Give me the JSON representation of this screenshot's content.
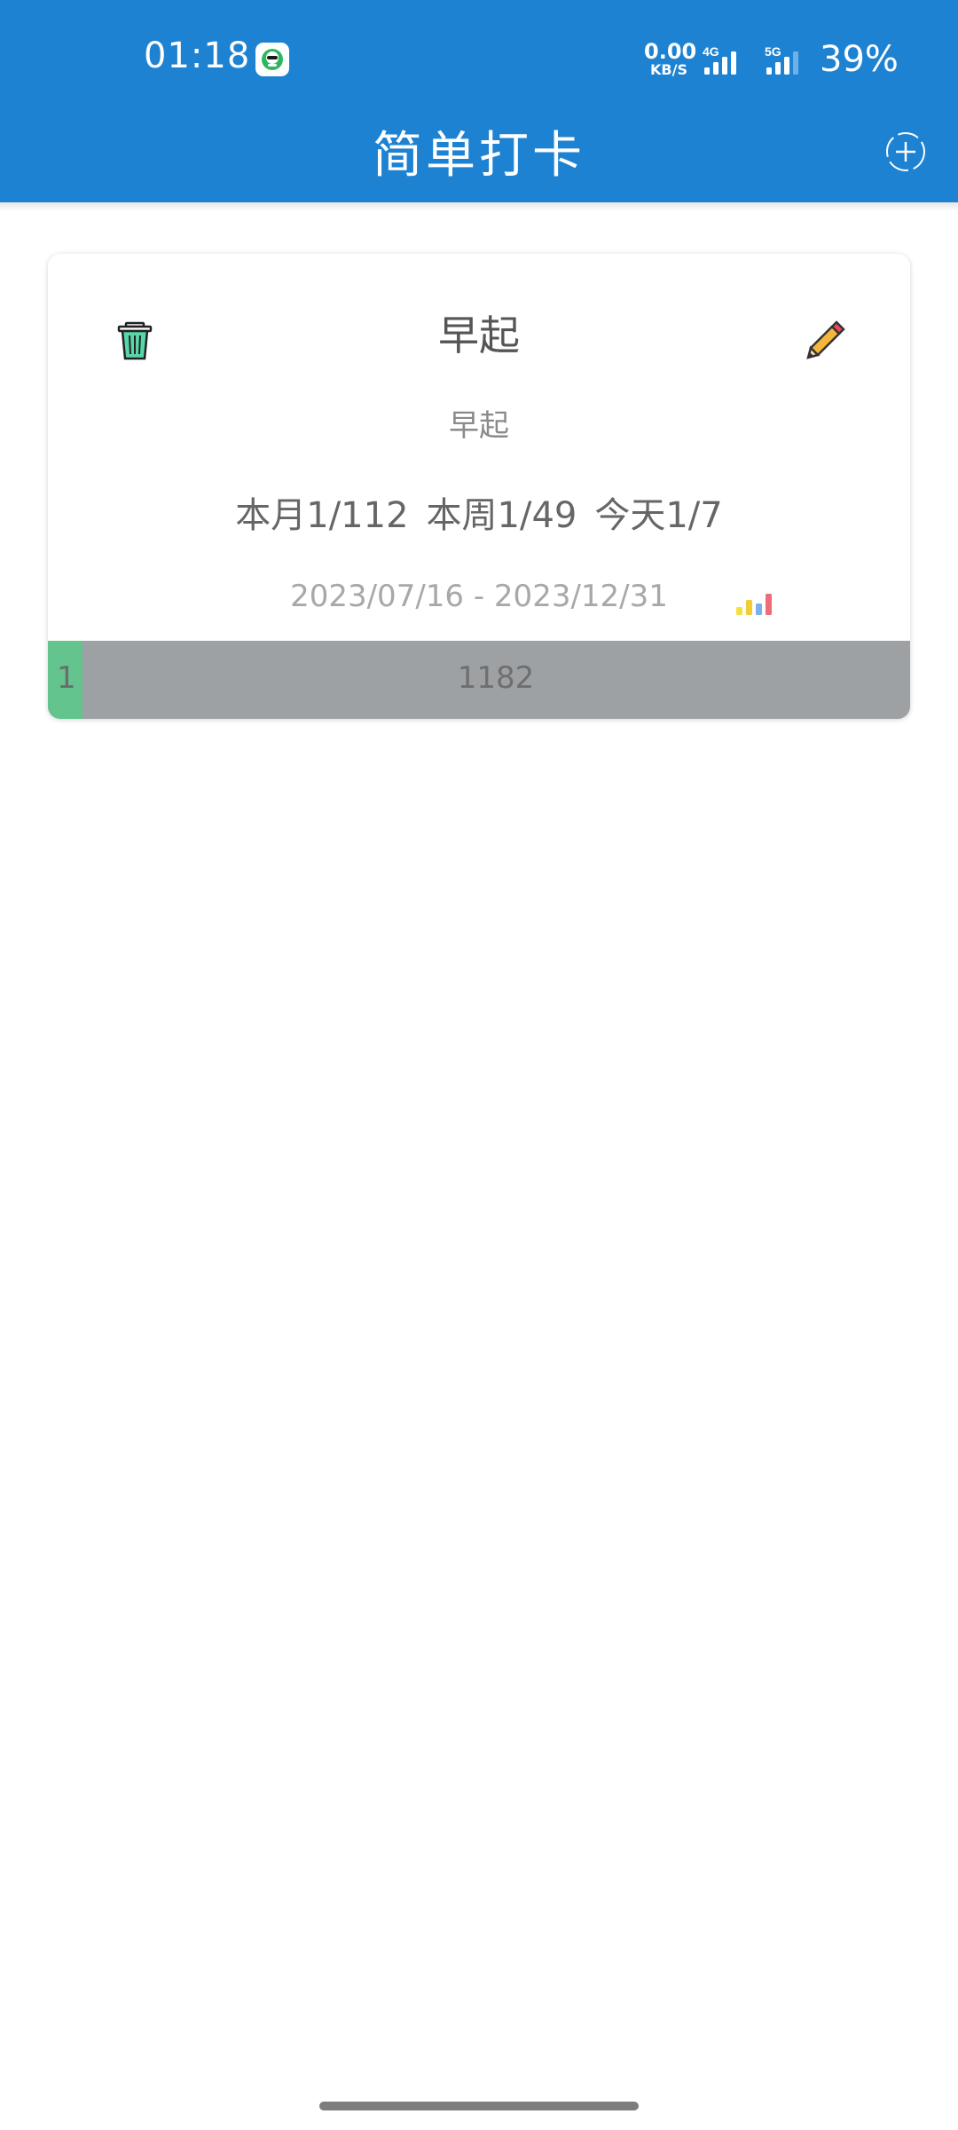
{
  "status_bar": {
    "time": "01:18",
    "net_speed_value": "0.00",
    "net_speed_unit": "KB/S",
    "signal1_label": "4G",
    "signal2_label": "5G",
    "battery": "39%"
  },
  "app_bar": {
    "title": "简单打卡",
    "add_icon": "add-circle-icon"
  },
  "card": {
    "title": "早起",
    "description": "早起",
    "stats": {
      "month": "本月1/112",
      "week": "本周1/49",
      "today": "今天1/7"
    },
    "date_range": "2023/07/16 - 2023/12/31",
    "progress": {
      "done": "1",
      "total": "1182",
      "fraction": 0.04
    },
    "icons": {
      "delete": "trash-icon",
      "edit": "pencil-icon",
      "stats": "bar-chart-icon"
    }
  },
  "colors": {
    "app_bar": "#1e82d2",
    "progress_fill": "#63c48e",
    "progress_track": "#9ea1a3"
  }
}
